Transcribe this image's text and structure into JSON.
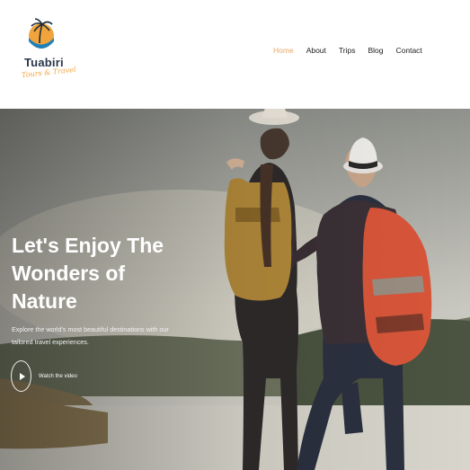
{
  "brand": {
    "name": "Tuabiri",
    "tagline": "Tours & Travel",
    "colors": {
      "accent": "#f1a43c",
      "navy": "#27364a"
    }
  },
  "nav": {
    "items": [
      {
        "label": "Home",
        "active": true
      },
      {
        "label": "About",
        "active": false
      },
      {
        "label": "Trips",
        "active": false
      },
      {
        "label": "Blog",
        "active": false
      },
      {
        "label": "Contact",
        "active": false
      }
    ],
    "active_color": "#e6a96a"
  },
  "hero": {
    "title": "Let's Enjoy The Wonders of Nature",
    "subtitle": "Explore the world's most beautiful destinations with our tailored travel experiences.",
    "video_label": "Watch the video",
    "icon": "play-icon"
  }
}
